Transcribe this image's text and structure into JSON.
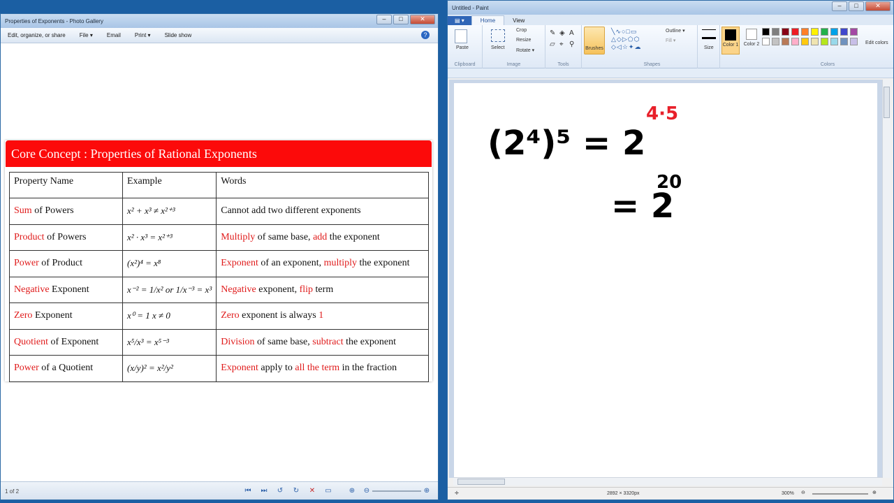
{
  "gallery": {
    "title": "Properties of Exponents - Photo Gallery",
    "toolbar": [
      "Edit, organize, or share",
      "File ▾",
      "Email",
      "Print ▾",
      "Slide show"
    ],
    "slide": {
      "banner": "Core Concept : Properties of Rational Exponents",
      "headers": [
        "Property Name",
        "Example",
        "Words"
      ],
      "rows": [
        {
          "name_red": "Sum",
          "name_rest": " of Powers",
          "example": "x² + x³ ≠ x²⁺³",
          "words": [
            {
              "t": "Cannot add two different exponents",
              "r": false
            }
          ]
        },
        {
          "name_red": "Product",
          "name_rest": " of Powers",
          "example": "x² · x³ = x²⁺³",
          "words": [
            {
              "t": "Multiply",
              "r": true
            },
            {
              "t": " of same base, ",
              "r": false
            },
            {
              "t": "add",
              "r": true
            },
            {
              "t": " the exponent",
              "r": false
            }
          ]
        },
        {
          "name_red": "Power",
          "name_rest": " of Product",
          "example": "(x²)⁴ = x⁸",
          "words": [
            {
              "t": "Exponent",
              "r": true
            },
            {
              "t": " of an exponent, ",
              "r": false
            },
            {
              "t": "multiply",
              "r": true
            },
            {
              "t": " the exponent",
              "r": false
            }
          ]
        },
        {
          "name_red": "Negative",
          "name_rest": " Exponent",
          "example": "x⁻² = 1/x²  or  1/x⁻³ = x³",
          "words": [
            {
              "t": "Negative",
              "r": true
            },
            {
              "t": " exponent, ",
              "r": false
            },
            {
              "t": "flip",
              "r": true
            },
            {
              "t": " term",
              "r": false
            }
          ]
        },
        {
          "name_red": "Zero",
          "name_rest": "  Exponent",
          "example": "x⁰ = 1     x ≠ 0",
          "words": [
            {
              "t": "Zero",
              "r": true
            },
            {
              "t": " exponent is always ",
              "r": false
            },
            {
              "t": "1",
              "r": true
            }
          ]
        },
        {
          "name_red": "Quotient",
          "name_rest": " of  Exponent",
          "example": "x⁵/x³ = x⁵⁻³",
          "words": [
            {
              "t": "Division",
              "r": true
            },
            {
              "t": " of same base, ",
              "r": false
            },
            {
              "t": "subtract",
              "r": true
            },
            {
              "t": " the exponent",
              "r": false
            }
          ]
        },
        {
          "name_red": "Power",
          "name_rest": " of a Quotient",
          "example": "(x/y)² = x²/y²",
          "words": [
            {
              "t": "Exponent",
              "r": true
            },
            {
              "t": " apply to ",
              "r": false
            },
            {
              "t": "all the term",
              "r": true
            },
            {
              "t": " in the fraction",
              "r": false
            }
          ]
        }
      ]
    },
    "page_info": "1 of 2"
  },
  "paint": {
    "title": "Untitled - Paint",
    "tabs": [
      "Home",
      "View"
    ],
    "groups": {
      "clipboard": "Clipboard",
      "image": "Image",
      "tools": "Tools",
      "shapes": "Shapes",
      "colors": "Colors"
    },
    "items": {
      "paste": "Paste",
      "select": "Select",
      "crop": "Crop",
      "resize": "Resize",
      "rotate": "Rotate ▾",
      "brushes": "Brushes",
      "outline": "Outline ▾",
      "fill": "Fill ▾",
      "size": "Size",
      "color1": "Color 1",
      "color2": "Color 2",
      "edit_colors": "Edit colors"
    },
    "palette": [
      "#000000",
      "#7f7f7f",
      "#880015",
      "#ed1c24",
      "#ff7f27",
      "#fff200",
      "#22b14c",
      "#00a2e8",
      "#3f48cc",
      "#a349a4",
      "#ffffff",
      "#c3c3c3",
      "#b97a57",
      "#ffaec9",
      "#ffc90e",
      "#efe4b0",
      "#b5e61d",
      "#99d9ea",
      "#7092be",
      "#c8bfe7"
    ],
    "drawing": {
      "line1_black": "(2⁴)⁵ = 2",
      "line1_red": "4·5",
      "line2_black": "= 2",
      "line2_super": "20"
    },
    "status": {
      "size": "2892 × 3320px",
      "zoom": "300%"
    }
  }
}
